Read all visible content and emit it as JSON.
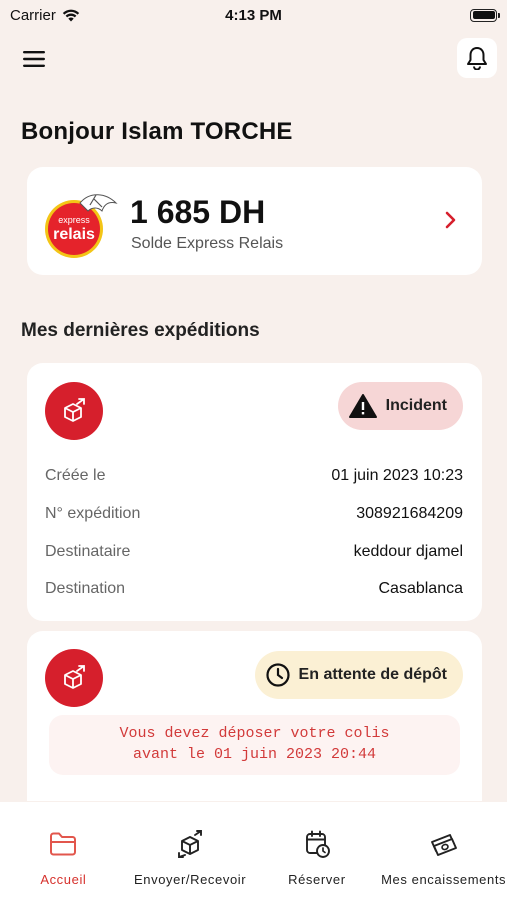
{
  "status_bar": {
    "carrier": "Carrier",
    "time": "4:13 PM"
  },
  "header": {
    "menu_icon": "hamburger-menu-icon",
    "notification_icon": "bell-icon"
  },
  "greeting": "Bonjour Islam TORCHE",
  "balance": {
    "logo_line1": "express",
    "logo_line2": "relais",
    "amount": "1 685 DH",
    "label": "Solde Express Relais"
  },
  "shipments_title": "Mes dernières expéditions",
  "shipments": [
    {
      "status": "Incident",
      "status_icon": "warning-triangle-icon",
      "fields": [
        {
          "label": "Créée le",
          "value": "01 juin 2023 10:23"
        },
        {
          "label": "N° expédition",
          "value": "308921684209"
        },
        {
          "label": "Destinataire",
          "value": "keddour djamel"
        },
        {
          "label": "Destination",
          "value": "Casablanca"
        }
      ]
    },
    {
      "status": "En attente de dépôt",
      "status_icon": "clock-icon",
      "warning_line1": "Vous devez déposer votre colis",
      "warning_line2": "avant le 01 juin 2023 20:44"
    }
  ],
  "tabs": [
    {
      "label": "Accueil",
      "icon": "folder-icon",
      "active": true
    },
    {
      "label": "Envoyer/Recevoir",
      "icon": "package-send-icon",
      "active": false
    },
    {
      "label": "Réserver",
      "icon": "calendar-clock-icon",
      "active": false
    },
    {
      "label": "Mes encaissements",
      "icon": "cash-icon",
      "active": false
    }
  ],
  "colors": {
    "brand_red": "#d61f2c",
    "background": "#f8f0ec",
    "incident_badge": "#f6d6d6",
    "pending_badge": "#fbf0d4",
    "warning_text": "#d23a3a"
  }
}
